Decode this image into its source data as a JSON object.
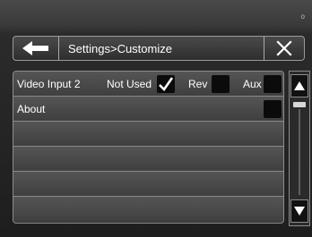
{
  "status": {
    "text": "o"
  },
  "header": {
    "back_icon": "left-arrow-icon",
    "title": "Settings>Customize",
    "close_icon": "close-icon"
  },
  "rows": [
    {
      "label": "Video Input 2",
      "options": [
        {
          "label": "Not Used",
          "checked": true
        },
        {
          "label": "Rev",
          "checked": false
        },
        {
          "label": "Aux",
          "checked": false
        }
      ]
    },
    {
      "label": "About",
      "options": [
        {
          "label": "",
          "checked": false
        }
      ]
    },
    {
      "label": ""
    },
    {
      "label": ""
    },
    {
      "label": ""
    },
    {
      "label": ""
    }
  ],
  "scrollbar": {
    "up_icon": "triangle-up-icon",
    "down_icon": "triangle-down-icon"
  },
  "colors": {
    "text": "#ffffff",
    "checkbox": "#0b0b0b",
    "border": "#8c8c8c"
  }
}
